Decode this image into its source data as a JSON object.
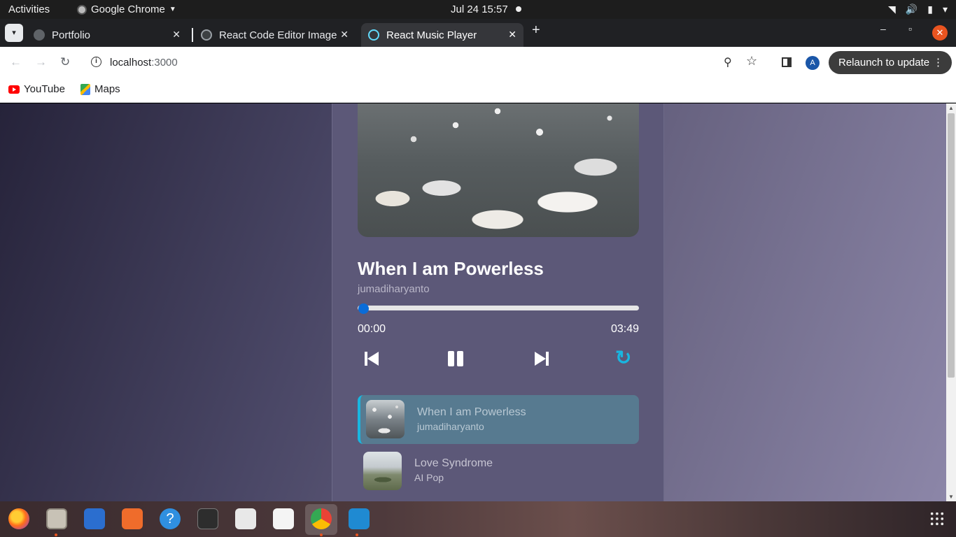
{
  "system_bar": {
    "activities": "Activities",
    "app_name": "Google Chrome",
    "clock": "Jul 24  15:57"
  },
  "browser": {
    "tabs": [
      {
        "label": "Portfolio",
        "active": false
      },
      {
        "label": "React Code Editor Image",
        "active": false
      },
      {
        "label": "React Music Player",
        "active": true
      }
    ],
    "url_host": "localhost",
    "url_port": ":3000",
    "relaunch_label": "Relaunch to update",
    "profile_initial": "A",
    "bookmarks": [
      {
        "label": "YouTube",
        "icon": "youtube-icon"
      },
      {
        "label": "Maps",
        "icon": "maps-icon"
      }
    ]
  },
  "player": {
    "now_playing": {
      "title": "When I am Powerless",
      "artist": "jumadiharyanto",
      "current_time": "00:00",
      "duration": "03:49",
      "progress_fraction": 0
    },
    "controls": {
      "previous": "previous-icon",
      "pause": "pause-icon",
      "next": "next-icon",
      "repeat": "repeat-icon",
      "repeat_color": "#19b6e0"
    },
    "playlist": [
      {
        "title": "When I am Powerless",
        "artist": "jumadiharyanto",
        "active": true
      },
      {
        "title": "Love Syndrome",
        "artist": "AI Pop",
        "active": false
      }
    ]
  },
  "colors": {
    "accent": "#19b6e0",
    "progress_knob": "#0a6cd8",
    "active_item_bg": "#577a90"
  },
  "dock": {
    "apps": [
      "firefox-icon",
      "files-icon",
      "writer-icon",
      "software-icon",
      "help-icon",
      "terminal-icon",
      "document-viewer-icon",
      "text-editor-icon",
      "chrome-icon",
      "vscode-icon"
    ]
  }
}
